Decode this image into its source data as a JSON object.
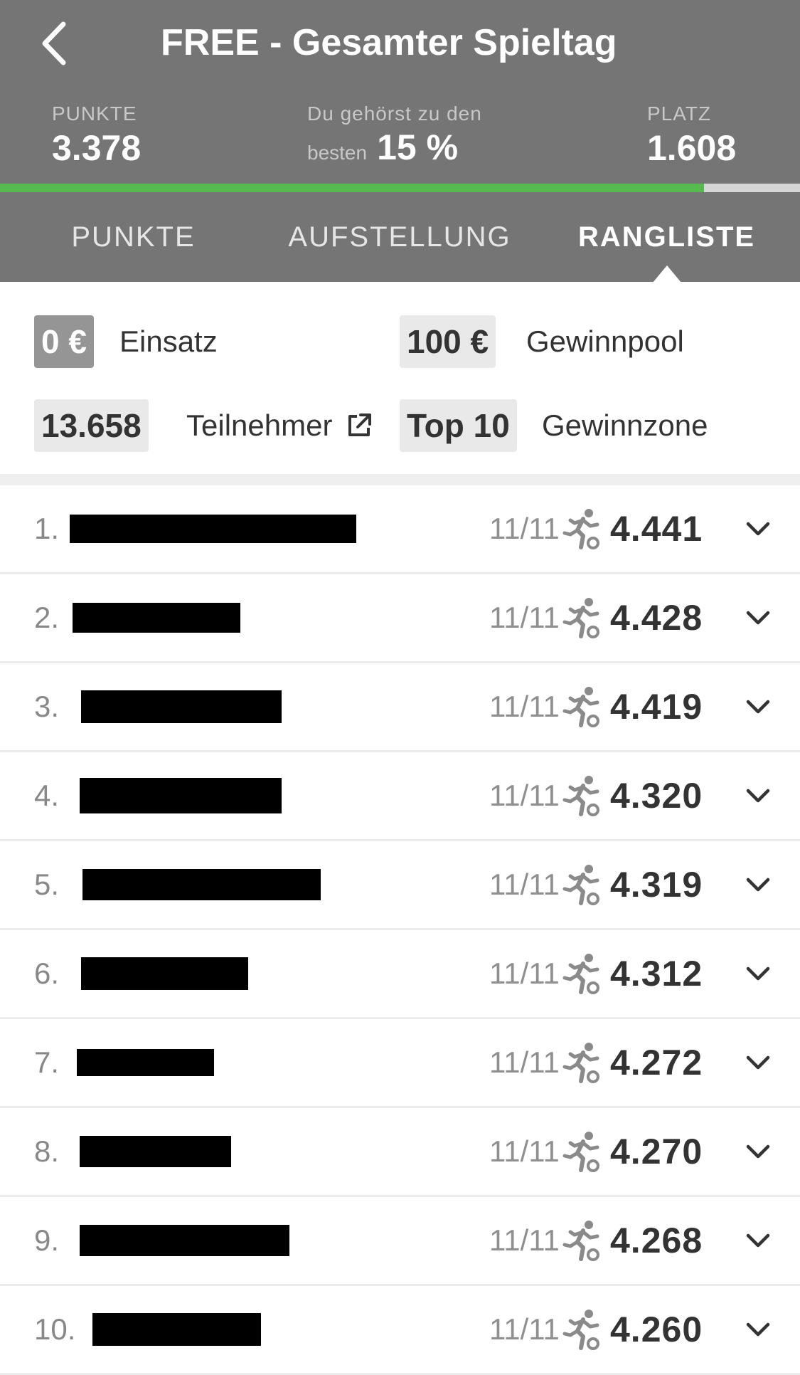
{
  "header": {
    "title": "FREE - Gesamter Spieltag",
    "stats": {
      "points_label": "PUNKTE",
      "points_value": "3.378",
      "percent_line1": "Du gehörst zu den",
      "percent_line2": "besten",
      "percent_value": "15 %",
      "rank_label": "PLATZ",
      "rank_value": "1.608"
    },
    "progress_fraction": 0.88
  },
  "tabs": [
    {
      "label": "PUNKTE",
      "active": false
    },
    {
      "label": "AUFSTELLUNG",
      "active": false
    },
    {
      "label": "RANGLISTE",
      "active": true
    }
  ],
  "info": {
    "stake_value": "0 €",
    "stake_label": "Einsatz",
    "pool_value": "100 €",
    "pool_label": "Gewinnpool",
    "participants_value": "13.658",
    "participants_label": "Teilnehmer",
    "zone_value": "Top 10",
    "zone_label": "Gewinnzone"
  },
  "colors": {
    "header_bg": "#757575",
    "progress": "#56b94f",
    "chip_bg": "#e9e9e9",
    "chip_dark": "#959595"
  },
  "icons": {
    "back": "chevron-left-icon",
    "external": "external-link-icon",
    "player": "running-player-icon",
    "expand": "chevron-down-icon"
  },
  "ranking": [
    {
      "rank": "1.",
      "count": "11/11",
      "score": "4.441"
    },
    {
      "rank": "2.",
      "count": "11/11",
      "score": "4.428"
    },
    {
      "rank": "3.",
      "count": "11/11",
      "score": "4.419"
    },
    {
      "rank": "4.",
      "count": "11/11",
      "score": "4.320"
    },
    {
      "rank": "5.",
      "count": "11/11",
      "score": "4.319"
    },
    {
      "rank": "6.",
      "count": "11/11",
      "score": "4.312"
    },
    {
      "rank": "7.",
      "count": "11/11",
      "score": "4.272"
    },
    {
      "rank": "8.",
      "count": "11/11",
      "score": "4.270"
    },
    {
      "rank": "9.",
      "count": "11/11",
      "score": "4.268"
    },
    {
      "rank": "10.",
      "count": "11/11",
      "score": "4.260"
    }
  ]
}
